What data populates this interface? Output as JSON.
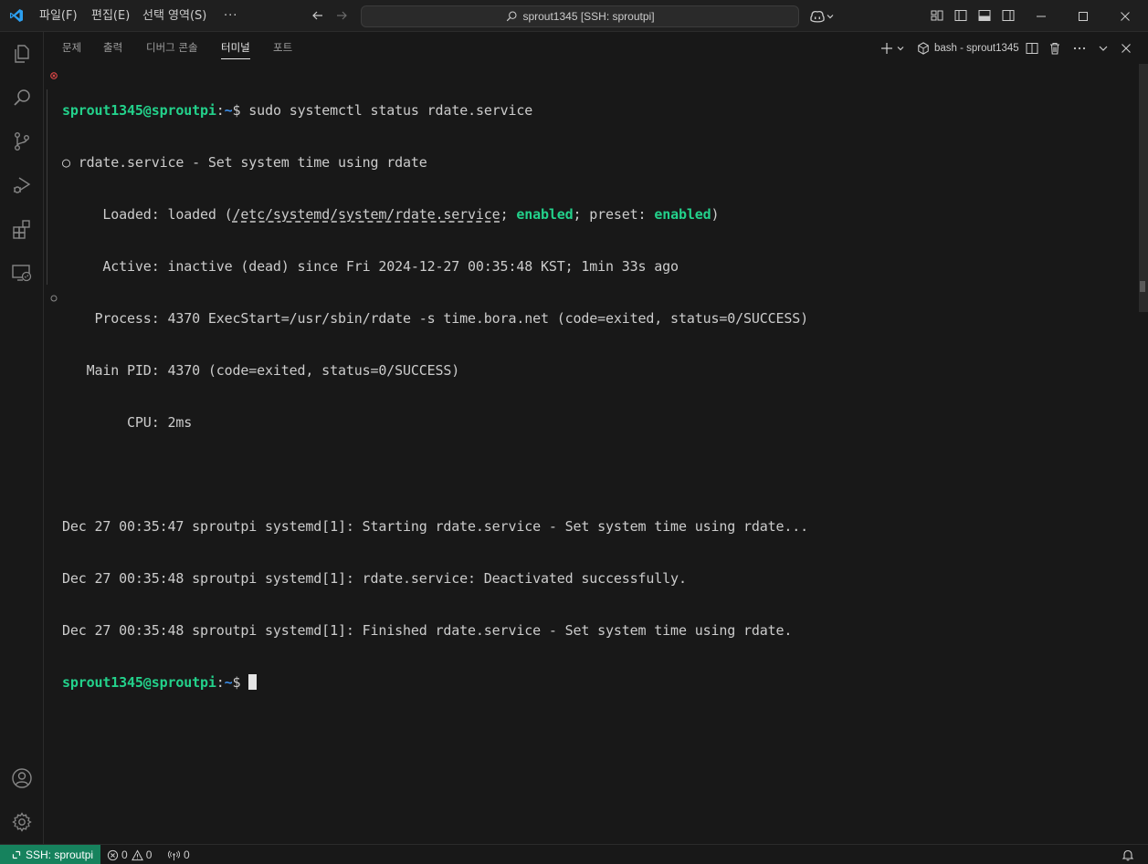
{
  "titlebar": {
    "menus": {
      "file": "파일(F)",
      "edit": "편집(E)",
      "selection": "선택 영역(S)",
      "more": "···"
    },
    "command_center": "sprout1345 [SSH: sproutpi]",
    "icons": [
      "vscode-logo-icon",
      "arrow-left-icon",
      "arrow-right-icon",
      "search-icon",
      "copilot-icon",
      "layout-icons",
      "minimize-icon",
      "maximize-icon",
      "close-icon"
    ]
  },
  "activitybar": {
    "items": [
      "explorer-icon",
      "search-icon",
      "source-control-icon",
      "run-debug-icon",
      "extensions-icon",
      "remote-explorer-icon"
    ],
    "bottom": [
      "account-icon",
      "settings-gear-icon"
    ]
  },
  "panel": {
    "tabs": [
      {
        "label": "문제",
        "active": false
      },
      {
        "label": "출력",
        "active": false
      },
      {
        "label": "디버그 콘솔",
        "active": false
      },
      {
        "label": "터미널",
        "active": true
      },
      {
        "label": "포트",
        "active": false
      }
    ],
    "terminal_name": "bash - sprout1345"
  },
  "terminal": {
    "prompt_user": "sprout1345@sproutpi",
    "prompt_path": "~",
    "prompt_symbol": "$",
    "command": " sudo systemctl status rdate.service",
    "status_header": "○ rdate.service - Set system time using rdate",
    "loaded_label": "     Loaded: ",
    "loaded_pre": "loaded (",
    "loaded_path": "/etc/systemd/system/rdate.service",
    "loaded_sep": "; ",
    "loaded_enabled": "enabled",
    "loaded_mid": "; preset: ",
    "loaded_preset": "enabled",
    "loaded_end": ")",
    "active_line": "     Active: inactive (dead) since Fri 2024-12-27 00:35:48 KST; 1min 33s ago",
    "process_line": "    Process: 4370 ExecStart=/usr/sbin/rdate -s time.bora.net (code=exited, status=0/SUCCESS)",
    "mainpid_line": "   Main PID: 4370 (code=exited, status=0/SUCCESS)",
    "cpu_line": "        CPU: 2ms",
    "log": [
      "Dec 27 00:35:47 sproutpi systemd[1]: Starting rdate.service - Set system time using rdate...",
      "Dec 27 00:35:48 sproutpi systemd[1]: rdate.service: Deactivated successfully.",
      "Dec 27 00:35:48 sproutpi systemd[1]: Finished rdate.service - Set system time using rdate."
    ]
  },
  "statusbar": {
    "remote": "SSH: sproutpi",
    "errors": "0",
    "warnings": "0",
    "ports": "0"
  },
  "colors": {
    "prompt_green": "#23d18b",
    "path_blue": "#3b8eea",
    "remote_bg": "#16825d",
    "error_deco": "#f14c4c"
  }
}
